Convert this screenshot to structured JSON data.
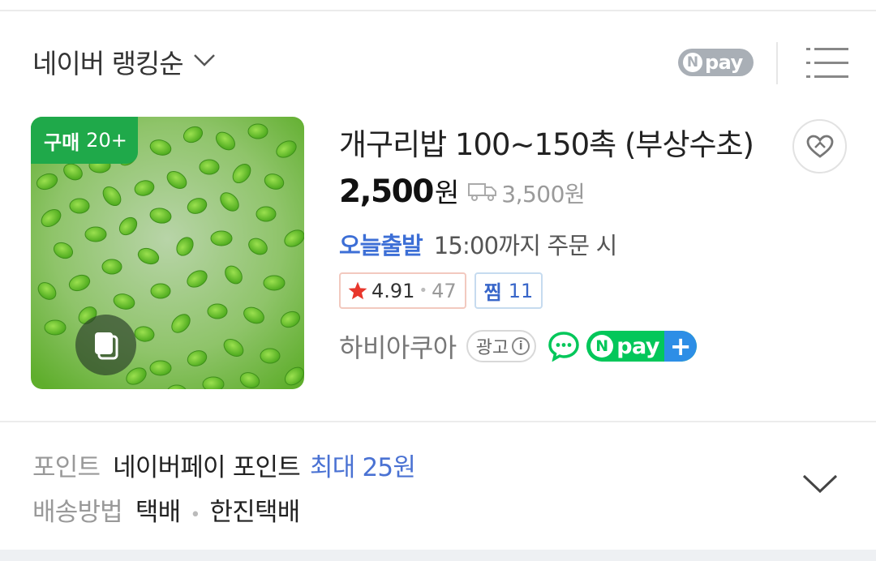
{
  "sort": {
    "label": "네이버 랭킹순",
    "icon": "chevron-down-icon"
  },
  "header": {
    "npay_badge": {
      "n": "N",
      "text": "pay"
    },
    "list_icon": "list-view-icon"
  },
  "product": {
    "purchase_badge": {
      "label": "구매",
      "count": "20+"
    },
    "title": "개구리밥 100~150촉 (부상수초)",
    "price": "2,500",
    "price_unit": "원",
    "shipping_fee": "3,500원",
    "dispatch_tag": "오늘출발",
    "dispatch_text": "15:00까지 주문 시",
    "rating": "4.91",
    "review_count": "47",
    "zzim": {
      "label": "찜",
      "count": "11"
    },
    "seller": "하비아쿠아",
    "ad_label": "광고",
    "ad_info": "i",
    "npayplus": {
      "n": "N",
      "text": "pay",
      "plus": "+"
    },
    "colors": {
      "badge_green": "#1fa94a",
      "accent_blue": "#3d6fd6",
      "star_red": "#e8372c",
      "npay_green": "#03c75a"
    }
  },
  "info": {
    "point_label": "포인트",
    "point_value": "네이버페이 포인트",
    "point_max": "최대 25원",
    "delivery_label": "배송방법",
    "delivery_type": "택배",
    "delivery_company": "한진택배"
  }
}
